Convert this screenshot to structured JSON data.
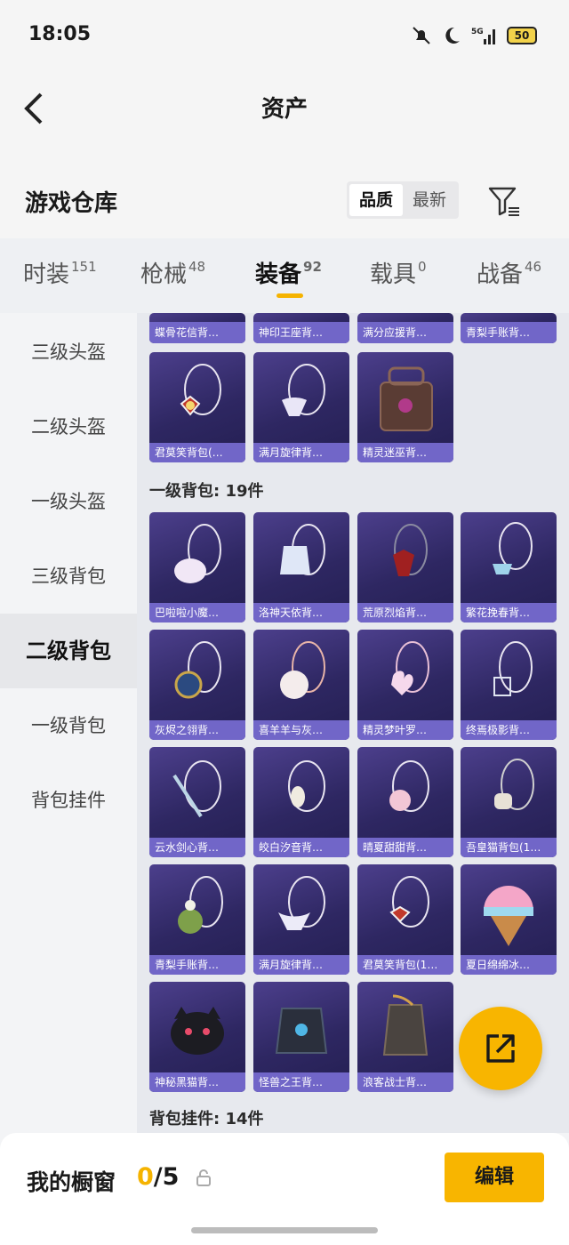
{
  "status": {
    "time": "18:05",
    "network": "5G",
    "battery": "50"
  },
  "header": {
    "title": "资产"
  },
  "warehouse": {
    "title": "游戏仓库",
    "sort_options": [
      "品质",
      "最新"
    ],
    "selected_sort": "品质"
  },
  "tabs": [
    {
      "label": "时装",
      "count": "151"
    },
    {
      "label": "枪械",
      "count": "48"
    },
    {
      "label": "装备",
      "count": "92",
      "active": true
    },
    {
      "label": "载具",
      "count": "0"
    },
    {
      "label": "战备",
      "count": "46"
    }
  ],
  "sidebar": {
    "items": [
      {
        "label": "三级头盔"
      },
      {
        "label": "二级头盔"
      },
      {
        "label": "一级头盔"
      },
      {
        "label": "三级背包"
      },
      {
        "label": "二级背包",
        "active": true
      },
      {
        "label": "一级背包"
      },
      {
        "label": "背包挂件"
      }
    ]
  },
  "content": {
    "partial_row": [
      "蝶骨花信背…",
      "神印王座背…",
      "满分应援背…",
      "青梨手账背…"
    ],
    "top_items": [
      "君莫笑背包(…",
      "满月旋律背…",
      "精灵迷巫背…"
    ],
    "section1": {
      "title": "一级背包: 19件"
    },
    "grid": [
      "巴啦啦小魔…",
      "洛神天依背…",
      "荒原烈焰背…",
      "繁花挽春背…",
      "灰烬之翎背…",
      "喜羊羊与灰…",
      "精灵梦叶罗…",
      "终焉极影背…",
      "云水剑心背…",
      "皎白汐音背…",
      "晴夏甜甜背…",
      "吾皇猫背包(1…",
      "青梨手账背…",
      "满月旋律背…",
      "君莫笑背包(1…",
      "夏日绵绵冰…",
      "神秘黑猫背…",
      "怪兽之王背…",
      "浪客战士背…"
    ],
    "section2": {
      "title": "背包挂件: 14件"
    }
  },
  "bottom": {
    "title": "我的橱窗",
    "current": "0",
    "total": "/5",
    "edit_label": "编辑"
  },
  "colors": {
    "accent": "#f8b500",
    "card_bg": "#2e2762",
    "card_label": "#7166c8"
  }
}
